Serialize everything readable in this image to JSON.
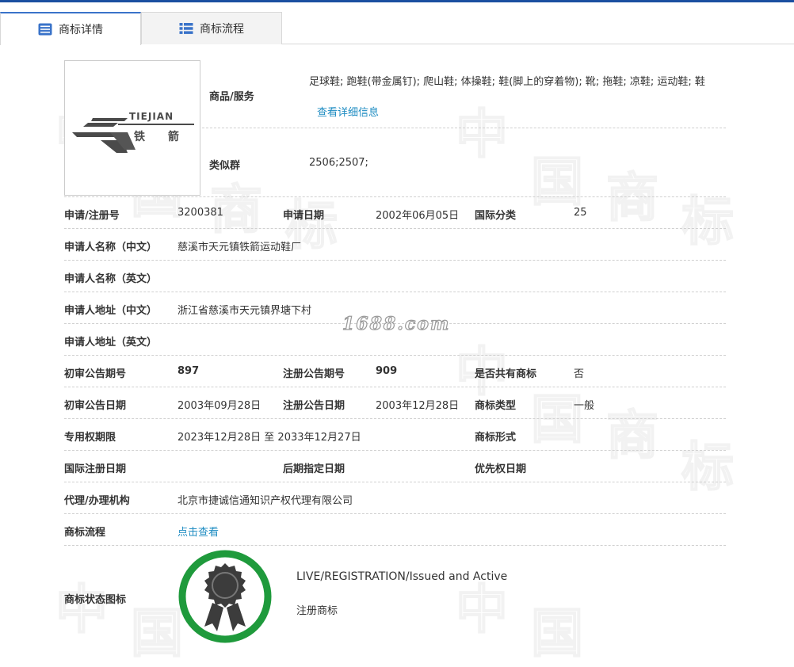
{
  "tabs": [
    {
      "label": "商标详情"
    },
    {
      "label": "商标流程"
    }
  ],
  "logo": {
    "text_en": "TIEJIAN",
    "text_cn": "铁 箭"
  },
  "goods": {
    "label": "商品/服务",
    "value": "足球鞋; 跑鞋(带金属钉); 爬山鞋; 体操鞋; 鞋(脚上的穿着物); 靴; 拖鞋; 凉鞋; 运动鞋; 鞋",
    "link": "查看详细信息"
  },
  "similar": {
    "label": "类似群",
    "value": "2506;2507;"
  },
  "rows": {
    "reg_no": {
      "label": "申请/注册号",
      "value": "3200381"
    },
    "app_date": {
      "label": "申请日期",
      "value": "2002年06月05日"
    },
    "intl_class": {
      "label": "国际分类",
      "value": "25"
    },
    "name_cn": {
      "label": "申请人名称（中文）",
      "value": "慈溪市天元镇铁箭运动鞋厂"
    },
    "name_en": {
      "label": "申请人名称（英文）",
      "value": ""
    },
    "addr_cn": {
      "label": "申请人地址（中文）",
      "value": "浙江省慈溪市天元镇界塘下村"
    },
    "addr_en": {
      "label": "申请人地址（英文）",
      "value": ""
    },
    "prelim_no": {
      "label": "初审公告期号",
      "value": "897"
    },
    "reg_pub_no": {
      "label": "注册公告期号",
      "value": "909"
    },
    "shared": {
      "label": "是否共有商标",
      "value": "否"
    },
    "prelim_date": {
      "label": "初审公告日期",
      "value": "2003年09月28日"
    },
    "reg_pub_date": {
      "label": "注册公告日期",
      "value": "2003年12月28日"
    },
    "tm_type": {
      "label": "商标类型",
      "value": "一般"
    },
    "excl_period": {
      "label": "专用权期限",
      "value": "2023年12月28日 至 2033年12月27日"
    },
    "tm_form": {
      "label": "商标形式",
      "value": ""
    },
    "intl_reg_date": {
      "label": "国际注册日期",
      "value": ""
    },
    "later_date": {
      "label": "后期指定日期",
      "value": ""
    },
    "priority_date": {
      "label": "优先权日期",
      "value": ""
    },
    "agent": {
      "label": "代理/办理机构",
      "value": "北京市捷诚信通知识产权代理有限公司"
    },
    "flow": {
      "label": "商标流程",
      "link": "点击查看"
    },
    "status": {
      "label": "商标状态图标",
      "en": "LIVE/REGISTRATION/Issued and Active",
      "cn": "注册商标"
    }
  },
  "watermark": {
    "site": "1688.com",
    "chars": [
      "中",
      "国",
      "商",
      "标"
    ]
  },
  "colors": {
    "accent": "#1b4fa0",
    "link": "#1e8cc2",
    "status_green": "#1f9a3c"
  }
}
